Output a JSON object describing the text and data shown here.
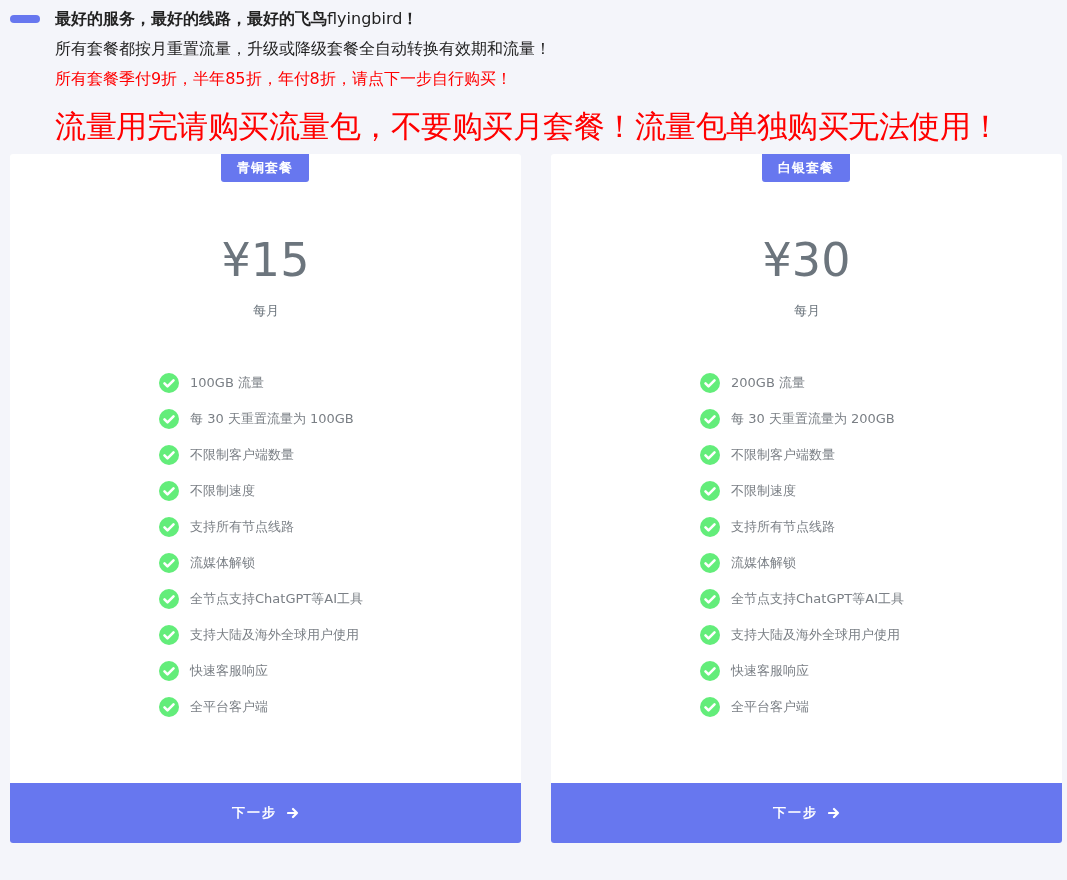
{
  "notice": {
    "headline": "**最好的服务，最好的线路，最好的飞鸟**flyingbird**！**",
    "lines": [
      {
        "text": "所有套餐都按月重置流量，升级或降级套餐全自动转换有效期和流量！",
        "kind": "normal"
      },
      {
        "text": "所有套餐季付9折，半年85折，年付8折，请点下一步自行购买！",
        "kind": "alert"
      }
    ]
  },
  "warning": "流量用完请购买流量包，不要购买月套餐！流量包单独购买无法使用！",
  "plans": [
    {
      "badge": "青铜套餐",
      "price": "¥15",
      "period": "每月",
      "features": [
        "100GB 流量",
        "每 30 天重置流量为 100GB",
        "不限制客户端数量",
        "不限制速度",
        "支持所有节点线路",
        "流媒体解锁",
        "全节点支持ChatGPT等AI工具",
        "支持大陆及海外全球用户使用",
        "快速客服响应",
        "全平台客户端"
      ],
      "button": "下一步"
    },
    {
      "badge": "白银套餐",
      "price": "¥30",
      "period": "每月",
      "features": [
        "200GB 流量",
        "每 30 天重置流量为 200GB",
        "不限制客户端数量",
        "不限制速度",
        "支持所有节点线路",
        "流媒体解锁",
        "全节点支持ChatGPT等AI工具",
        "支持大陆及海外全球用户使用",
        "快速客服响应",
        "全平台客户端"
      ],
      "button": "下一步"
    }
  ]
}
